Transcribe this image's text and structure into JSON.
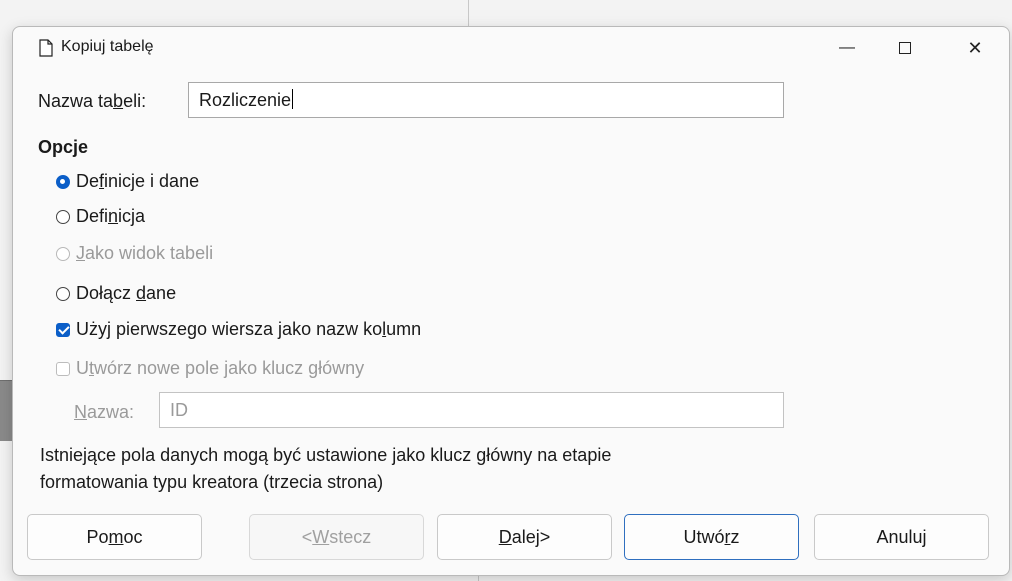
{
  "window": {
    "title": "Kopiuj tabelę",
    "controls": {
      "minimize": "—",
      "close": "✕"
    }
  },
  "table_name": {
    "label_parts": [
      "Nazwa ta",
      "b",
      "eli:"
    ],
    "value": "Rozliczenie"
  },
  "options": {
    "heading": "Opcje",
    "items": [
      {
        "type": "radio",
        "state": "selected",
        "parts": [
          "De",
          "f",
          "inicje i dane"
        ]
      },
      {
        "type": "radio",
        "state": "unselected",
        "parts": [
          "Defi",
          "n",
          "icja"
        ]
      },
      {
        "type": "radio",
        "state": "disabled",
        "parts": [
          "",
          "J",
          "ako widok tabeli"
        ]
      },
      {
        "type": "radio",
        "state": "unselected",
        "parts": [
          "Dołącz ",
          "d",
          "ane"
        ]
      },
      {
        "type": "checkbox",
        "state": "checked",
        "parts": [
          "Użyj pierwszego wiersza jako nazw ko",
          "l",
          "umn"
        ]
      },
      {
        "type": "checkbox",
        "state": "disabled",
        "parts": [
          "U",
          "t",
          "wórz nowe pole jako klucz główny"
        ]
      }
    ]
  },
  "key_name": {
    "label_parts": [
      "",
      "N",
      "azwa:"
    ],
    "value": "ID"
  },
  "info_text_line1": "Istniejące pola danych mogą być ustawione jako klucz główny na etapie",
  "info_text_line2": "formatowania typu kreatora (trzecia strona)",
  "buttons": [
    {
      "parts": [
        "Po",
        "m",
        "oc"
      ],
      "state": "normal"
    },
    {
      "parts": [
        "< ",
        "W",
        "stecz"
      ],
      "state": "disabled"
    },
    {
      "parts": [
        "",
        "D",
        "alej>"
      ],
      "state": "normal"
    },
    {
      "parts": [
        "Utwó",
        "r",
        "z"
      ],
      "state": "default"
    },
    {
      "parts": [
        "Anuluj",
        "",
        ""
      ],
      "state": "normal"
    }
  ],
  "colors": {
    "accent": "#0b5ec8",
    "dialog_bg": "#fafafa",
    "disabled_text": "#9a9a9a"
  }
}
